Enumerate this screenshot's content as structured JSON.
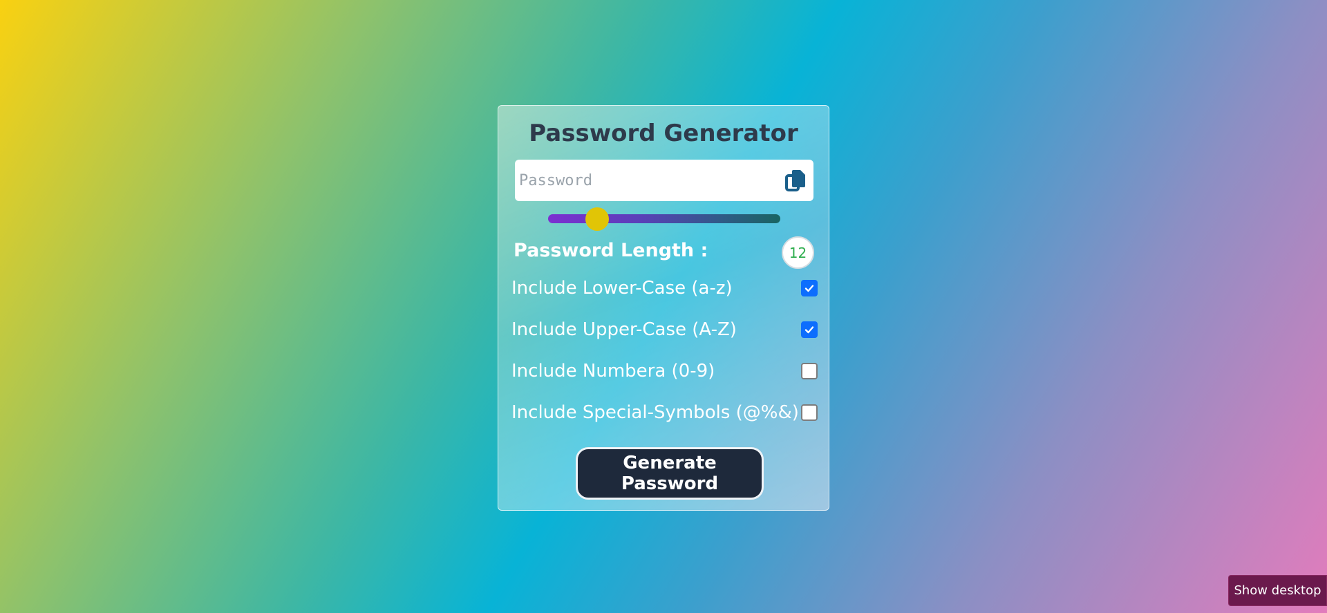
{
  "app": {
    "title": "Password Generator"
  },
  "password": {
    "value": "",
    "placeholder": "Password",
    "copy_icon": "copy-icon"
  },
  "length": {
    "label": "Password Length :",
    "value": "12",
    "slider_fraction": 0.21
  },
  "options": [
    {
      "label": "Include Lower-Case (a-z)",
      "checked": true
    },
    {
      "label": "Include Upper-Case (A-Z)",
      "checked": true
    },
    {
      "label": "Include Numbera (0-9)",
      "checked": false
    },
    {
      "label": "Include Special-Symbols (@%&)",
      "checked": false
    }
  ],
  "generate_button": {
    "label": "Generate Password"
  },
  "taskbar": {
    "show_desktop_label": "Show desktop"
  },
  "colors": {
    "card_title": "#2e3a4b",
    "slider_thumb": "#e1c506",
    "length_value": "#2fae4e",
    "checkbox_checked": "#0d6efd",
    "button_bg": "#1e293b",
    "show_desktop_bg": "#6b1a4d"
  }
}
